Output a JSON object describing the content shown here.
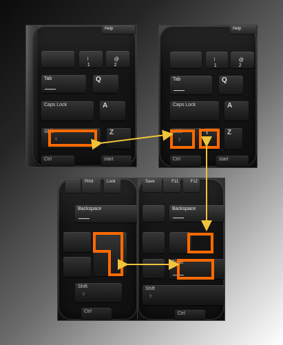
{
  "panels": {
    "top_left": {
      "help": "Help",
      "tab": "Tab",
      "caps_lock": "Caps Lock",
      "shift": "Shift",
      "ctrl": "Ctrl",
      "start": "start",
      "q": "Q",
      "a": "A",
      "z": "Z",
      "one": "1",
      "bang": "!",
      "at": "@",
      "two": "2"
    },
    "top_right": {
      "help": "Help",
      "tab": "Tab",
      "caps_lock": "Caps Lock",
      "shift": "Shift",
      "ctrl": "Ctrl",
      "start": "start",
      "q": "Q",
      "a": "A",
      "z": "Z",
      "one": "1",
      "bang": "!",
      "at": "@",
      "two": "2",
      "backslash": "\\"
    },
    "bottom_left": {
      "print": "Print",
      "lock": "Lock",
      "backspace": "Backspace",
      "shift": "Shift",
      "ctrl": "Ctrl"
    },
    "bottom_right": {
      "save": "Save",
      "f11": "F11",
      "f12": "F12",
      "backspace": "Backspace",
      "enter": "Enter",
      "shift": "Shift",
      "ctrl": "Ctrl"
    }
  },
  "colors": {
    "highlight": "#ff6a00",
    "arrow": "#f0c43a"
  }
}
